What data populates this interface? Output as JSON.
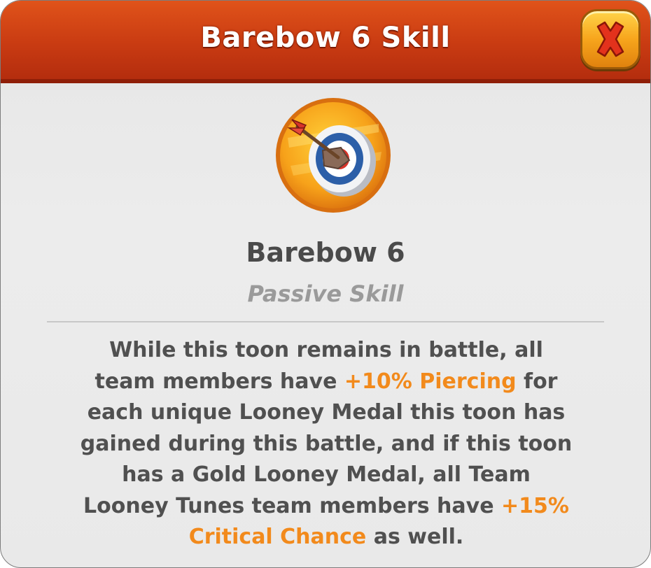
{
  "dialog": {
    "title": "Barebow 6 Skill",
    "close_icon": "close-x-icon"
  },
  "skill": {
    "icon": "bullseye-arrow-icon",
    "name": "Barebow 6",
    "type": "Passive Skill"
  },
  "description": {
    "line1": "While this toon remains in battle, all",
    "line2_a": "team members have ",
    "line2_hl": "+10% Piercing",
    "line2_b": " for",
    "line3": "each unique Looney Medal this toon has",
    "line4": "gained during this battle, and if this toon",
    "line5": "has a Gold Looney Medal, all Team",
    "line6_a": "Looney Tunes team members have ",
    "line6_hl": "+15%",
    "line7_hl": "Critical Chance",
    "line7_b": " as well."
  },
  "colors": {
    "header": "#c93b12",
    "highlight": "#f28a1c",
    "text": "#505050",
    "subtitle": "#9a9a9a",
    "close_button": "#f7a51c"
  }
}
